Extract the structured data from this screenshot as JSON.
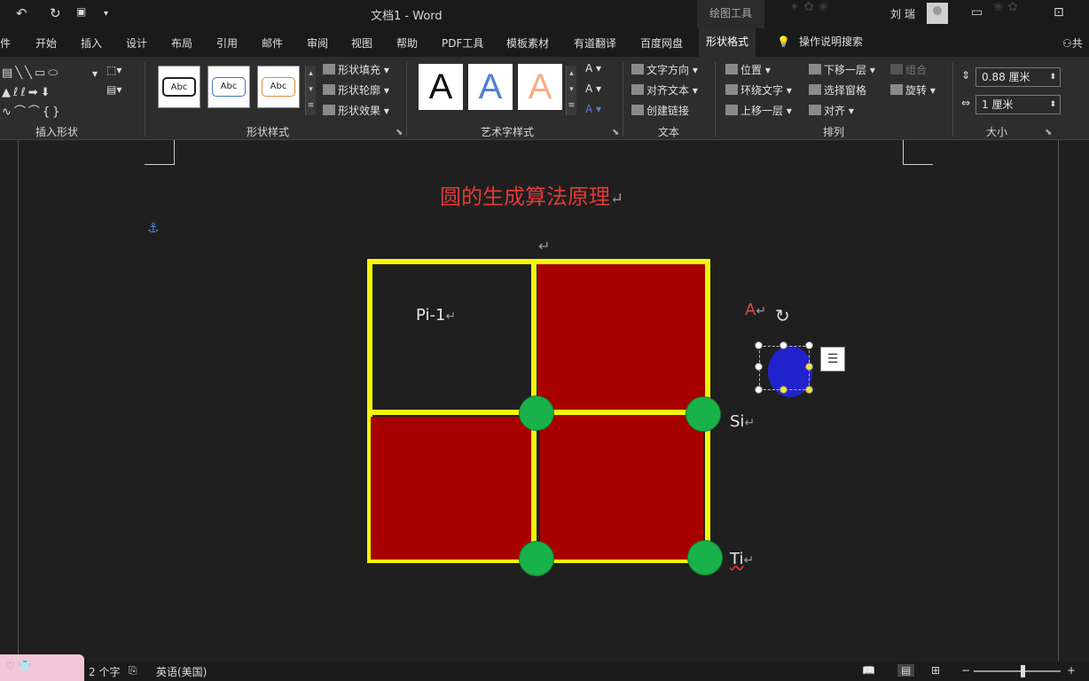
{
  "titlebar": {
    "doc_title": "文档1  -  Word",
    "context_tab": "绘图工具",
    "user": "刘 瑞",
    "undo": "↶",
    "redo": "↻",
    "maximize": "⊡"
  },
  "tabs": [
    {
      "label": "件"
    },
    {
      "label": "开始"
    },
    {
      "label": "插入"
    },
    {
      "label": "设计"
    },
    {
      "label": "布局"
    },
    {
      "label": "引用"
    },
    {
      "label": "邮件"
    },
    {
      "label": "审阅"
    },
    {
      "label": "视图"
    },
    {
      "label": "帮助"
    },
    {
      "label": "PDF工具"
    },
    {
      "label": "模板素材"
    },
    {
      "label": "有道翻译"
    },
    {
      "label": "百度网盘"
    },
    {
      "label": "形状格式"
    }
  ],
  "tell_me": "操作说明搜索",
  "share": "共",
  "ribbon": {
    "groups": {
      "insert_shapes": "插入形状",
      "shape_styles": "形状样式",
      "wordart_styles": "艺术字样式",
      "text": "文本",
      "arrange": "排列",
      "size": "大小"
    },
    "style_sample": "Abc",
    "wordart_sample": "A",
    "shape_fill": "形状填充",
    "shape_outline": "形状轮廓",
    "shape_effects": "形状效果",
    "text_direction": "文字方向",
    "align_text": "对齐文本",
    "create_link": "创建链接",
    "position": "位置",
    "wrap_text": "环绕文字",
    "bring_forward": "上移一层",
    "send_backward": "下移一层",
    "selection_pane": "选择窗格",
    "align": "对齐",
    "group": "组合",
    "rotate": "旋转",
    "height": "0.88 厘米",
    "width": "1 厘米"
  },
  "document": {
    "heading": "圆的生成算法原理",
    "para_mark": "↵",
    "anchor": "⚓",
    "label_pi": "Pi-1",
    "label_si": "Si",
    "label_ti": "Ti",
    "label_a": "A"
  },
  "statusbar": {
    "word_count": "2 个字",
    "language": "英语(美国)",
    "zoom_minus": "−",
    "zoom_plus": "+"
  },
  "colors": {
    "accent_yellow": "#f5f50a",
    "fill_red": "#a80000",
    "dot_green": "#19b24a",
    "circle_blue": "#2222cc",
    "heading_red": "#e03a3a"
  }
}
